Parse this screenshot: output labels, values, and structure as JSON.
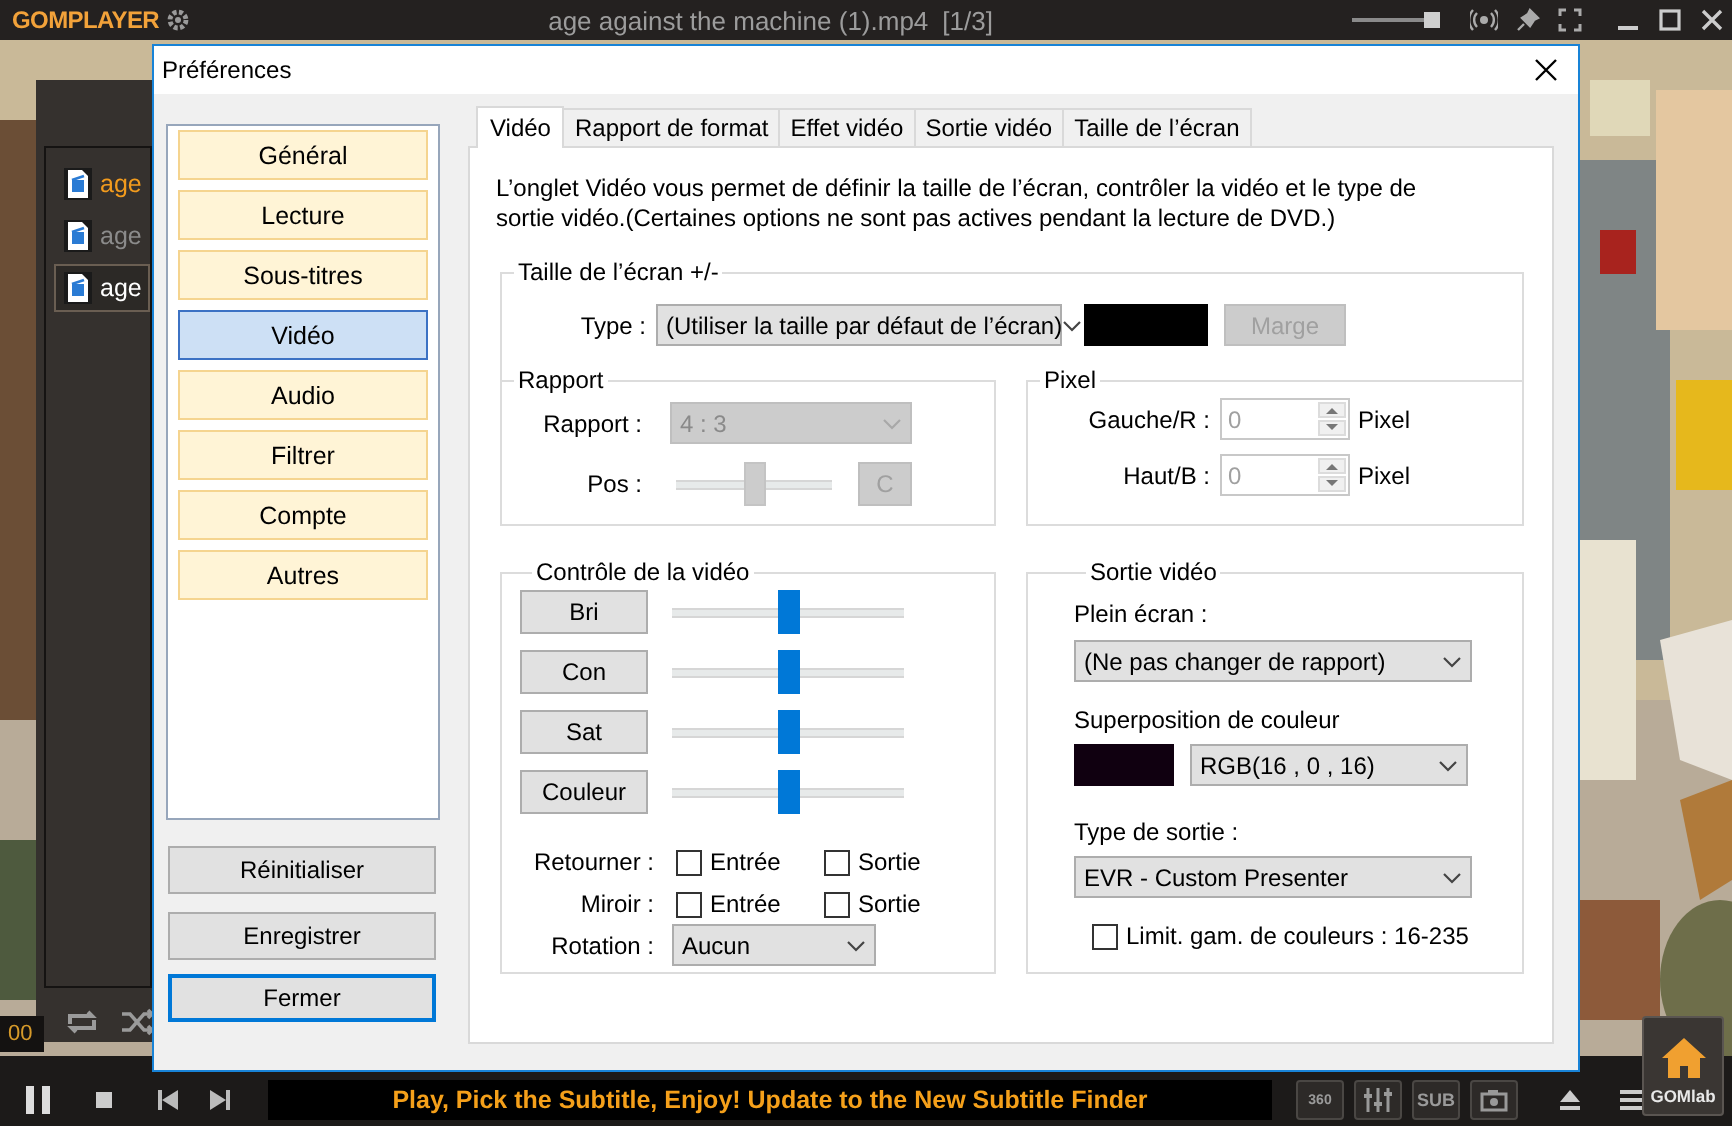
{
  "player": {
    "logo": "GOMPLAYER",
    "file_title": "age against the machine (1).mp4",
    "counter": "[1/3]",
    "volume": {
      "level": 0.9
    },
    "playlist": [
      {
        "label": "age",
        "playing": true,
        "selected": false
      },
      {
        "label": "age",
        "playing": false,
        "selected": false
      },
      {
        "label": "age",
        "playing": false,
        "selected": true
      }
    ],
    "time": "00",
    "marquee": "Play, Pick the Subtitle, Enjoy! Update to the New Subtitle Finder",
    "vr_button": "360",
    "subtitle_button": "SUB",
    "brand_button": "GOMlab"
  },
  "dialog": {
    "title": "Préférences",
    "categories": [
      {
        "label": "Général",
        "selected": false
      },
      {
        "label": "Lecture",
        "selected": false
      },
      {
        "label": "Sous-titres",
        "selected": false
      },
      {
        "label": "Vidéo",
        "selected": true
      },
      {
        "label": "Audio",
        "selected": false
      },
      {
        "label": "Filtrer",
        "selected": false
      },
      {
        "label": "Compte",
        "selected": false
      },
      {
        "label": "Autres",
        "selected": false
      }
    ],
    "buttons": [
      {
        "label": "Réinitialiser",
        "focused": false
      },
      {
        "label": "Enregistrer",
        "focused": false
      },
      {
        "label": "Fermer",
        "focused": true
      }
    ],
    "tabs": [
      {
        "label": "Vidéo",
        "selected": true
      },
      {
        "label": "Rapport de format",
        "selected": false
      },
      {
        "label": "Effet vidéo",
        "selected": false
      },
      {
        "label": "Sortie vidéo",
        "selected": false
      },
      {
        "label": "Taille de l’écran",
        "selected": false
      }
    ],
    "description": "L’onglet Vidéo vous permet de définir la taille de l’écran, contrôler la vidéo et le type de sortie vidéo.(Certaines options ne sont pas actives pendant la lecture de DVD.)",
    "screen_size": {
      "title": "Taille de l’écran +/-",
      "type_label": "Type :",
      "type_value": "(Utiliser la taille par défaut de l’écran)",
      "margin_button": {
        "label": "Marge",
        "disabled": true
      }
    },
    "ratio": {
      "title": "Rapport",
      "ratio_label": "Rapport :",
      "ratio_value": "4 : 3",
      "ratio_disabled": true,
      "pos_label": "Pos :",
      "pos": {
        "level": 0.5,
        "disabled": true
      },
      "center_button": {
        "label": "C",
        "disabled": true
      }
    },
    "pixel": {
      "title": "Pixel",
      "rows": [
        {
          "label": "Gauche/R :",
          "value": "0",
          "unit": "Pixel",
          "disabled": true
        },
        {
          "label": "Haut/B :",
          "value": "0",
          "unit": "Pixel",
          "disabled": true
        }
      ]
    },
    "video_control": {
      "title": "Contrôle de la vidéo",
      "sliders": [
        {
          "label": "Bri",
          "level": 0.5
        },
        {
          "label": "Con",
          "level": 0.5
        },
        {
          "label": "Sat",
          "level": 0.5
        },
        {
          "label": "Couleur",
          "level": 0.5
        }
      ],
      "flip_rows": [
        {
          "label": "Retourner :",
          "options": [
            {
              "label": "Entrée",
              "checked": false
            },
            {
              "label": "Sortie",
              "checked": false
            }
          ]
        },
        {
          "label": "Miroir :",
          "options": [
            {
              "label": "Entrée",
              "checked": false
            },
            {
              "label": "Sortie",
              "checked": false
            }
          ]
        }
      ],
      "rotation_label": "Rotation :",
      "rotation_value": "Aucun"
    },
    "video_output": {
      "title": "Sortie vidéo",
      "fullscreen_label": "Plein écran :",
      "fullscreen_value": "(Ne pas changer de rapport)",
      "overlay_label": "Superposition de couleur",
      "overlay_value": "RGB(16 , 0 , 16)",
      "output_label": "Type de sortie :",
      "output_value": "EVR - Custom Presenter",
      "limit": {
        "label": "Limit. gam. de couleurs : 16-235",
        "checked": false
      }
    }
  }
}
